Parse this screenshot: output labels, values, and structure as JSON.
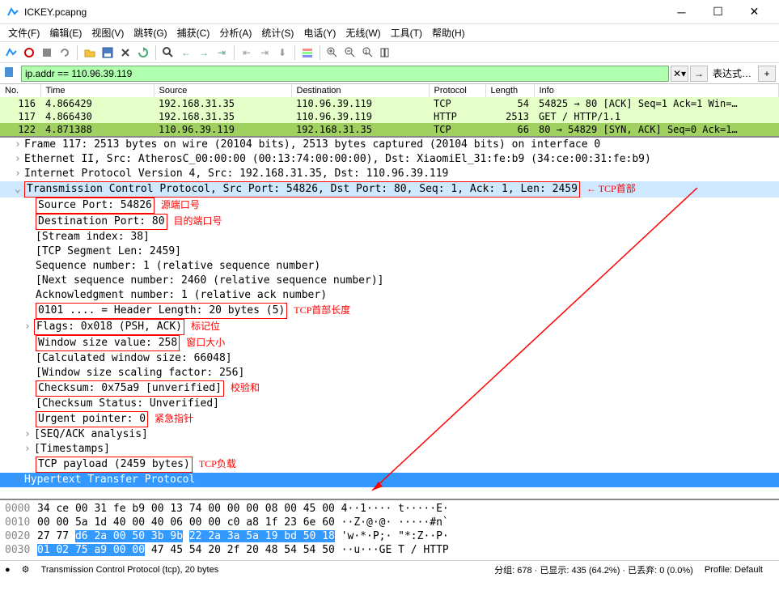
{
  "title": "ICKEY.pcapng",
  "menu": [
    "文件(F)",
    "编辑(E)",
    "视图(V)",
    "跳转(G)",
    "捕获(C)",
    "分析(A)",
    "统计(S)",
    "电话(Y)",
    "无线(W)",
    "工具(T)",
    "帮助(H)"
  ],
  "filter": {
    "value": "ip.addr == 110.96.39.119",
    "expr_label": "表达式…"
  },
  "packet_headers": [
    "No.",
    "Time",
    "Source",
    "Destination",
    "Protocol",
    "Length",
    "Info"
  ],
  "packets": [
    {
      "no": "116",
      "time": "4.866429",
      "src": "192.168.31.35",
      "dst": "110.96.39.119",
      "proto": "TCP",
      "len": "54",
      "info": "54825 → 80 [ACK] Seq=1 Ack=1 Win=…",
      "cls": "row-green"
    },
    {
      "no": "117",
      "time": "4.866430",
      "src": "192.168.31.35",
      "dst": "110.96.39.119",
      "proto": "HTTP",
      "len": "2513",
      "info": "GET / HTTP/1.1",
      "cls": "row-green"
    },
    {
      "no": "122",
      "time": "4.871388",
      "src": "110.96.39.119",
      "dst": "192.168.31.35",
      "proto": "TCP",
      "len": "66",
      "info": "80 → 54829 [SYN, ACK] Seq=0 Ack=1…",
      "cls": "row-dark"
    }
  ],
  "details": {
    "frame": "Frame 117: 2513 bytes on wire (20104 bits), 2513 bytes captured (20104 bits) on interface 0",
    "eth": "Ethernet II, Src: AtherosC_00:00:00 (00:13:74:00:00:00), Dst: XiaomiEl_31:fe:b9 (34:ce:00:31:fe:b9)",
    "ip": "Internet Protocol Version 4, Src: 192.168.31.35, Dst: 110.96.39.119",
    "tcp": "Transmission Control Protocol, Src Port: 54826, Dst Port: 80, Seq: 1, Ack: 1, Len: 2459",
    "tcp_label": "TCP首部",
    "src_port": "Source Port: 54826",
    "src_port_label": "源端口号",
    "dst_port": "Destination Port: 80",
    "dst_port_label": "目的端口号",
    "stream": "[Stream index: 38]",
    "seglen": "[TCP Segment Len: 2459]",
    "seq": "Sequence number: 1    (relative sequence number)",
    "nextseq": "[Next sequence number: 2460    (relative sequence number)]",
    "ack": "Acknowledgment number: 1    (relative ack number)",
    "hdrlen": "0101 .... = Header Length: 20 bytes (5)",
    "hdrlen_label": "TCP首部长度",
    "flags": "Flags: 0x018 (PSH, ACK)",
    "flags_label": "标记位",
    "winsize": "Window size value: 258",
    "winsize_label": "窗口大小",
    "calcwin": "[Calculated window size: 66048]",
    "winscale": "[Window size scaling factor: 256]",
    "checksum": "Checksum: 0x75a9 [unverified]",
    "checksum_label": "校验和",
    "checkstat": "[Checksum Status: Unverified]",
    "urgent": "Urgent pointer: 0",
    "urgent_label": "紧急指针",
    "seqack": "[SEQ/ACK analysis]",
    "timestamps": "[Timestamps]",
    "payload": "TCP payload (2459 bytes)",
    "payload_label": "TCP负载",
    "http": "Hypertext Transfer Protocol"
  },
  "hex": [
    {
      "off": "0000",
      "bytes1": "34 ce 00 31 fe b9 00 13",
      "bytes2": "74 00 00 00 08 00 45 00",
      "ascii": "4··1···· t·····E·"
    },
    {
      "off": "0010",
      "bytes1": "00 00 5a 1d 40 00 40 06",
      "bytes2": "00 00 c0 a8 1f 23 6e 60",
      "ascii": "··Z·@·@· ·····#n`"
    },
    {
      "off": "0020",
      "bytes1": "27 77 ",
      "hl1": "d6 2a 00 50 3b 9b",
      "bytes1b": "",
      "hl2": "22 2a 3a 5a 19 bd 50 18",
      "ascii": "'w·*·P;· \"*:Z··P·"
    },
    {
      "off": "0030",
      "hl3": "01 02 75 a9 00 00",
      "bytes3": " 47 45",
      "bytes4": "54 20 2f 20 48 54 54 50",
      "ascii": "··u···GE T / HTTP"
    }
  ],
  "status": {
    "proto": "Transmission Control Protocol (tcp), 20 bytes",
    "pkts": "分组: 678 · 已显示: 435 (64.2%) · 已丢弃: 0 (0.0%)",
    "profile": "Profile: Default"
  }
}
